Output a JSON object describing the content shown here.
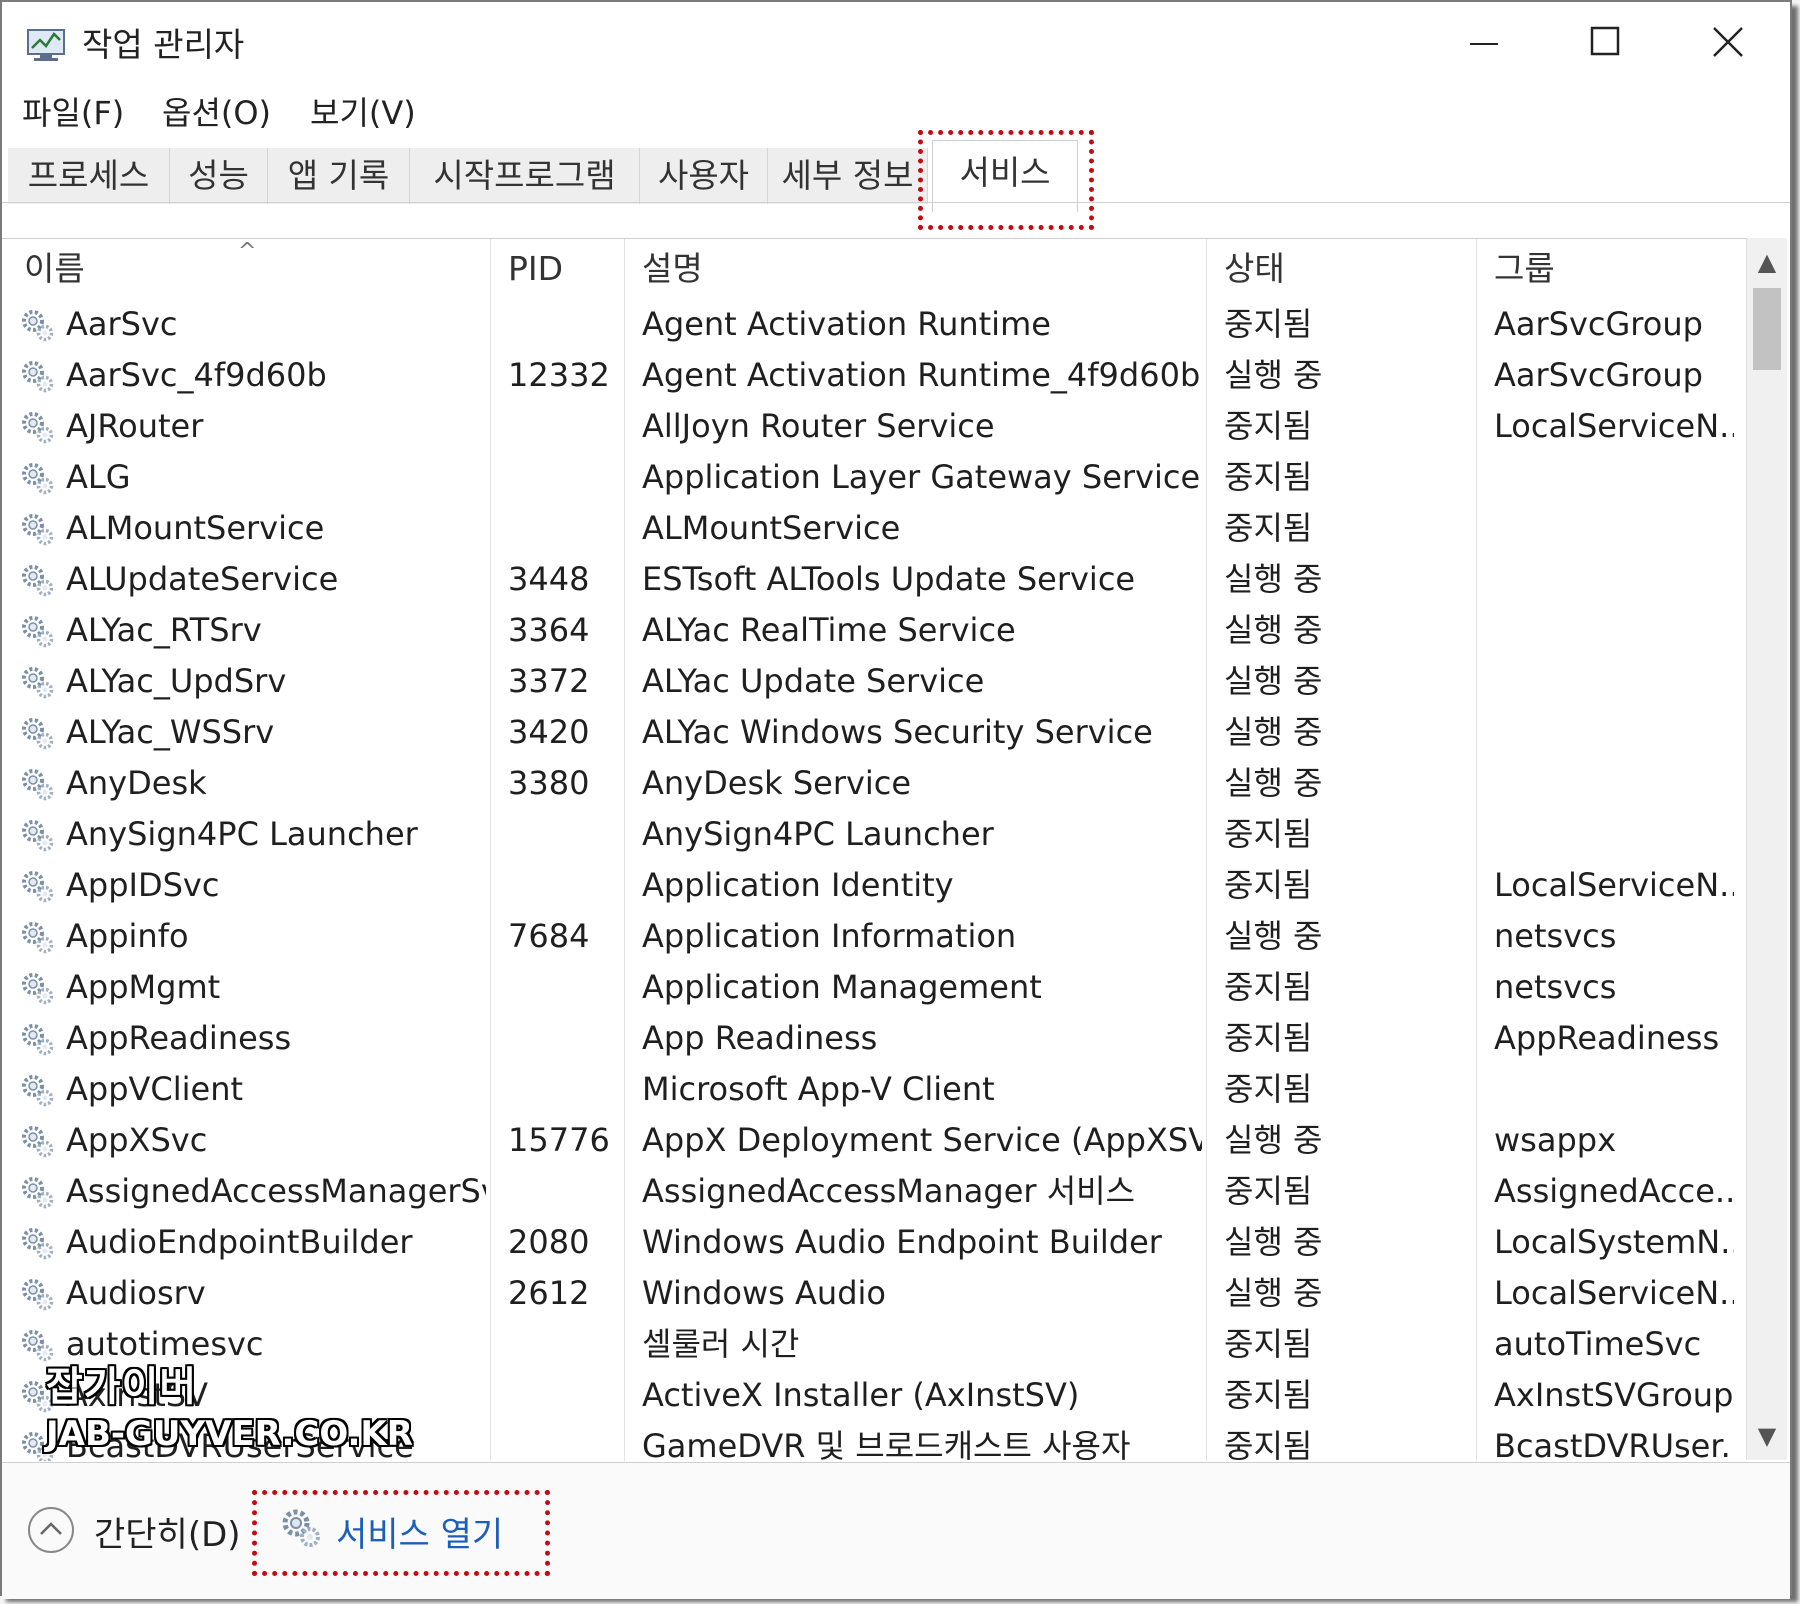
{
  "window": {
    "title": "작업 관리자"
  },
  "controls": {
    "minimize_icon": "minimize-icon",
    "maximize_icon": "maximize-icon",
    "close_icon": "close-icon"
  },
  "menu": [
    "파일(F)",
    "옵션(O)",
    "보기(V)"
  ],
  "tabs": [
    {
      "label": "프로세스"
    },
    {
      "label": "성능"
    },
    {
      "label": "앱 기록"
    },
    {
      "label": "시작프로그램"
    },
    {
      "label": "사용자"
    },
    {
      "label": "세부 정보"
    },
    {
      "label": "서비스",
      "active": true
    }
  ],
  "columns": {
    "name": "이름",
    "pid": "PID",
    "desc": "설명",
    "status": "상태",
    "group": "그룹"
  },
  "rows": [
    {
      "name": "AarSvc",
      "pid": "",
      "desc": "Agent Activation Runtime",
      "status": "중지됨",
      "group": "AarSvcGroup"
    },
    {
      "name": "AarSvc_4f9d60b",
      "pid": "12332",
      "desc": "Agent Activation Runtime_4f9d60b",
      "status": "실행 중",
      "group": "AarSvcGroup"
    },
    {
      "name": "AJRouter",
      "pid": "",
      "desc": "AllJoyn Router Service",
      "status": "중지됨",
      "group": "LocalServiceN..."
    },
    {
      "name": "ALG",
      "pid": "",
      "desc": "Application Layer Gateway Service",
      "status": "중지됨",
      "group": ""
    },
    {
      "name": "ALMountService",
      "pid": "",
      "desc": "ALMountService",
      "status": "중지됨",
      "group": ""
    },
    {
      "name": "ALUpdateService",
      "pid": "3448",
      "desc": "ESTsoft ALTools Update Service",
      "status": "실행 중",
      "group": ""
    },
    {
      "name": "ALYac_RTSrv",
      "pid": "3364",
      "desc": "ALYac RealTime Service",
      "status": "실행 중",
      "group": ""
    },
    {
      "name": "ALYac_UpdSrv",
      "pid": "3372",
      "desc": "ALYac Update Service",
      "status": "실행 중",
      "group": ""
    },
    {
      "name": "ALYac_WSSrv",
      "pid": "3420",
      "desc": "ALYac Windows Security Service",
      "status": "실행 중",
      "group": ""
    },
    {
      "name": "AnyDesk",
      "pid": "3380",
      "desc": "AnyDesk Service",
      "status": "실행 중",
      "group": ""
    },
    {
      "name": "AnySign4PC Launcher",
      "pid": "",
      "desc": "AnySign4PC Launcher",
      "status": "중지됨",
      "group": ""
    },
    {
      "name": "AppIDSvc",
      "pid": "",
      "desc": "Application Identity",
      "status": "중지됨",
      "group": "LocalServiceN..."
    },
    {
      "name": "Appinfo",
      "pid": "7684",
      "desc": "Application Information",
      "status": "실행 중",
      "group": "netsvcs"
    },
    {
      "name": "AppMgmt",
      "pid": "",
      "desc": "Application Management",
      "status": "중지됨",
      "group": "netsvcs"
    },
    {
      "name": "AppReadiness",
      "pid": "",
      "desc": "App Readiness",
      "status": "중지됨",
      "group": "AppReadiness"
    },
    {
      "name": "AppVClient",
      "pid": "",
      "desc": "Microsoft App-V Client",
      "status": "중지됨",
      "group": ""
    },
    {
      "name": "AppXSvc",
      "pid": "15776",
      "desc": "AppX Deployment Service (AppXSV...",
      "status": "실행 중",
      "group": "wsappx"
    },
    {
      "name": "AssignedAccessManagerSvc",
      "pid": "",
      "desc": "AssignedAccessManager 서비스",
      "status": "중지됨",
      "group": "AssignedAcce..."
    },
    {
      "name": "AudioEndpointBuilder",
      "pid": "2080",
      "desc": "Windows Audio Endpoint Builder",
      "status": "실행 중",
      "group": "LocalSystemN..."
    },
    {
      "name": "Audiosrv",
      "pid": "2612",
      "desc": "Windows Audio",
      "status": "실행 중",
      "group": "LocalServiceN..."
    },
    {
      "name": "autotimesvc",
      "pid": "",
      "desc": "셀룰러 시간",
      "status": "중지됨",
      "group": "autoTimeSvc"
    },
    {
      "name": "AxInstSV",
      "pid": "",
      "desc": "ActiveX Installer (AxInstSV)",
      "status": "중지됨",
      "group": "AxInstSVGroup"
    },
    {
      "name": "BcastDVRUserService",
      "pid": "",
      "desc": "GameDVR 및 브로드캐스트 사용자",
      "status": "중지됨",
      "group": "BcastDVRUser..."
    }
  ],
  "footer": {
    "fewer_details": "간단히(D)",
    "open_services": "서비스 열기"
  },
  "watermark": {
    "line1": "잡가이버",
    "line2": "JAB-GUYVER.CO.KR"
  },
  "colors": {
    "highlight": "#c40b12",
    "link": "#1c5fb8"
  }
}
